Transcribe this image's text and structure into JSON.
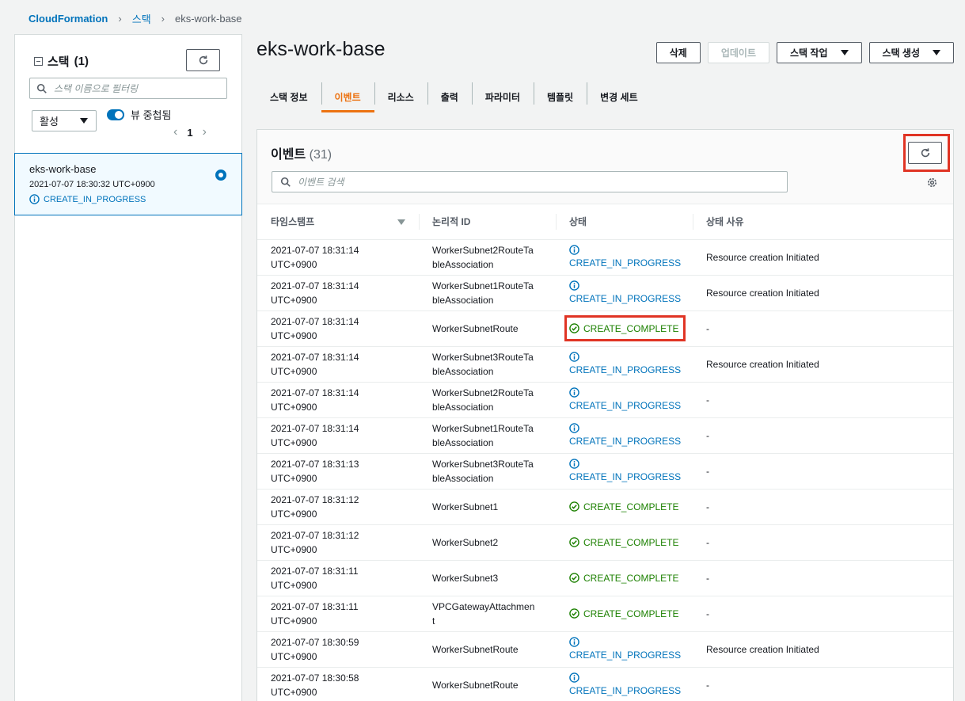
{
  "breadcrumb": {
    "root": "CloudFormation",
    "section": "스택",
    "current": "eks-work-base"
  },
  "sidebar": {
    "title": "스택",
    "count": "(1)",
    "filter_placeholder": "스택 이름으로 필터링",
    "status_select": "활성",
    "nested_toggle_label": "뷰 중첩됨",
    "page": "1",
    "stack": {
      "name": "eks-work-base",
      "time": "2021-07-07 18:30:32 UTC+0900",
      "status": "CREATE_IN_PROGRESS"
    }
  },
  "main": {
    "title": "eks-work-base",
    "buttons": {
      "delete": "삭제",
      "update": "업데이트",
      "stack_actions": "스택 작업",
      "create_stack": "스택 생성"
    },
    "tabs": [
      "스택 정보",
      "이벤트",
      "리소스",
      "출력",
      "파라미터",
      "템플릿",
      "변경 세트"
    ],
    "active_tab": "이벤트"
  },
  "events": {
    "title": "이벤트",
    "count": "(31)",
    "search_placeholder": "이벤트 검색",
    "columns": [
      "타임스탬프",
      "논리적 ID",
      "상태",
      "상태 사유"
    ],
    "rows": [
      {
        "ts1": "2021-07-07 18:31:14",
        "ts2": "UTC+0900",
        "id1": "WorkerSubnet2RouteTa",
        "id2": "bleAssociation",
        "status": "CREATE_IN_PROGRESS",
        "reason": "Resource creation Initiated"
      },
      {
        "ts1": "2021-07-07 18:31:14",
        "ts2": "UTC+0900",
        "id1": "WorkerSubnet1RouteTa",
        "id2": "bleAssociation",
        "status": "CREATE_IN_PROGRESS",
        "reason": "Resource creation Initiated"
      },
      {
        "ts1": "2021-07-07 18:31:14",
        "ts2": "UTC+0900",
        "id1": "WorkerSubnetRoute",
        "id2": "",
        "status": "CREATE_COMPLETE",
        "reason": "-"
      },
      {
        "ts1": "2021-07-07 18:31:14",
        "ts2": "UTC+0900",
        "id1": "WorkerSubnet3RouteTa",
        "id2": "bleAssociation",
        "status": "CREATE_IN_PROGRESS",
        "reason": "Resource creation Initiated"
      },
      {
        "ts1": "2021-07-07 18:31:14",
        "ts2": "UTC+0900",
        "id1": "WorkerSubnet2RouteTa",
        "id2": "bleAssociation",
        "status": "CREATE_IN_PROGRESS",
        "reason": "-"
      },
      {
        "ts1": "2021-07-07 18:31:14",
        "ts2": "UTC+0900",
        "id1": "WorkerSubnet1RouteTa",
        "id2": "bleAssociation",
        "status": "CREATE_IN_PROGRESS",
        "reason": "-"
      },
      {
        "ts1": "2021-07-07 18:31:13",
        "ts2": "UTC+0900",
        "id1": "WorkerSubnet3RouteTa",
        "id2": "bleAssociation",
        "status": "CREATE_IN_PROGRESS",
        "reason": "-"
      },
      {
        "ts1": "2021-07-07 18:31:12",
        "ts2": "UTC+0900",
        "id1": "WorkerSubnet1",
        "id2": "",
        "status": "CREATE_COMPLETE",
        "reason": "-"
      },
      {
        "ts1": "2021-07-07 18:31:12",
        "ts2": "UTC+0900",
        "id1": "WorkerSubnet2",
        "id2": "",
        "status": "CREATE_COMPLETE",
        "reason": "-"
      },
      {
        "ts1": "2021-07-07 18:31:11",
        "ts2": "UTC+0900",
        "id1": "WorkerSubnet3",
        "id2": "",
        "status": "CREATE_COMPLETE",
        "reason": "-"
      },
      {
        "ts1": "2021-07-07 18:31:11",
        "ts2": "UTC+0900",
        "id1": "VPCGatewayAttachmen",
        "id2": "t",
        "status": "CREATE_COMPLETE",
        "reason": "-"
      },
      {
        "ts1": "2021-07-07 18:30:59",
        "ts2": "UTC+0900",
        "id1": "WorkerSubnetRoute",
        "id2": "",
        "status": "CREATE_IN_PROGRESS",
        "reason": "Resource creation Initiated"
      },
      {
        "ts1": "2021-07-07 18:30:58",
        "ts2": "UTC+0900",
        "id1": "WorkerSubnetRoute",
        "id2": "",
        "status": "CREATE_IN_PROGRESS",
        "reason": "-"
      }
    ]
  },
  "colors": {
    "link": "#0073bb",
    "success": "#1d8102",
    "active_tab": "#ec7211",
    "highlight": "#e03424"
  }
}
